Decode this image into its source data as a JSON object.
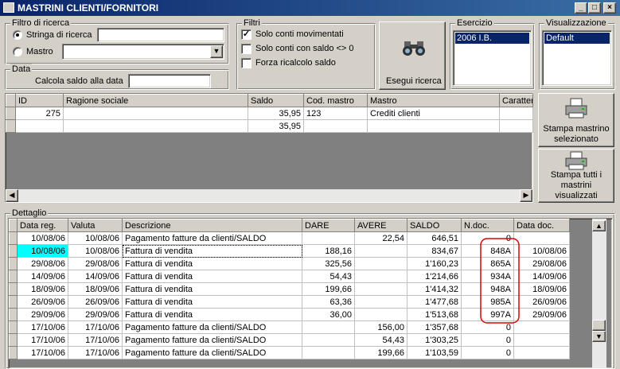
{
  "window": {
    "title": "MASTRINI CLIENTI/FORNITORI",
    "controls": {
      "minimize": "_",
      "maximize": "□",
      "close": "×"
    }
  },
  "filter": {
    "group_label": "Filtro di ricerca",
    "radio_search_label": "Stringa di ricerca",
    "radio_search_selected": true,
    "search_value": "",
    "radio_mastro_label": "Mastro",
    "mastro_value": ""
  },
  "data_group": {
    "label": "Data",
    "calc_label": "Calcola saldo alla data",
    "date_value": ""
  },
  "filtri": {
    "label": "Filtri",
    "options": [
      {
        "label": "Solo conti movimentati",
        "checked": "✓"
      },
      {
        "label": "Solo conti con saldo <> 0",
        "checked": ""
      },
      {
        "label": "Forza ricalcolo saldo",
        "checked": ""
      }
    ]
  },
  "search_button": {
    "label": "Esegui ricerca",
    "icon": "binoculars-icon"
  },
  "esercizio": {
    "label": "Esercizio",
    "items": [
      "2006 I.B."
    ]
  },
  "visualizzazione": {
    "label": "Visualizzazione",
    "items": [
      "Default"
    ]
  },
  "print_buttons": {
    "selected": "Stampa mastrino selezionato",
    "all": "Stampa tutti i mastrini visualizzati"
  },
  "accounts_table": {
    "headers": [
      "ID",
      "Ragione sociale",
      "Saldo",
      "Cod. mastro",
      "Mastro",
      "Caratterist"
    ],
    "rows": [
      [
        "275",
        "",
        "35,95",
        "123",
        "Crediti clienti",
        ""
      ],
      [
        "",
        "",
        "35,95",
        "",
        "",
        ""
      ]
    ]
  },
  "detail": {
    "label": "Dettaglio",
    "headers": [
      "Data reg.",
      "Valuta",
      "Descrizione",
      "DARE",
      "AVERE",
      "SALDO",
      "N.doc.",
      "Data doc."
    ],
    "rows": [
      [
        "10/08/06",
        "10/08/06",
        "Pagamento fatture da clienti/SALDO",
        "",
        "22,54",
        "646,51",
        "0",
        ""
      ],
      [
        "10/08/06",
        "10/08/06",
        "Fattura di vendita",
        "188,16",
        "",
        "834,67",
        "848A",
        "10/08/06"
      ],
      [
        "29/08/06",
        "29/08/06",
        "Fattura di vendita",
        "325,56",
        "",
        "1'160,23",
        "865A",
        "29/08/06"
      ],
      [
        "14/09/06",
        "14/09/06",
        "Fattura di vendita",
        "54,43",
        "",
        "1'214,66",
        "934A",
        "14/09/06"
      ],
      [
        "18/09/06",
        "18/09/06",
        "Fattura di vendita",
        "199,66",
        "",
        "1'414,32",
        "948A",
        "18/09/06"
      ],
      [
        "26/09/06",
        "26/09/06",
        "Fattura di vendita",
        "63,36",
        "",
        "1'477,68",
        "985A",
        "26/09/06"
      ],
      [
        "29/09/06",
        "29/09/06",
        "Fattura di vendita",
        "36,00",
        "",
        "1'513,68",
        "997A",
        "29/09/06"
      ],
      [
        "17/10/06",
        "17/10/06",
        "Pagamento fatture da clienti/SALDO",
        "",
        "156,00",
        "1'357,68",
        "0",
        ""
      ],
      [
        "17/10/06",
        "17/10/06",
        "Pagamento fatture da clienti/SALDO",
        "",
        "54,43",
        "1'303,25",
        "0",
        ""
      ],
      [
        "17/10/06",
        "17/10/06",
        "Pagamento fatture da clienti/SALDO",
        "",
        "199,66",
        "1'103,59",
        "0",
        ""
      ]
    ]
  },
  "colors": {
    "selection": "#00ffff",
    "title_bar": "#0a246a",
    "annotation": "#e00000"
  }
}
